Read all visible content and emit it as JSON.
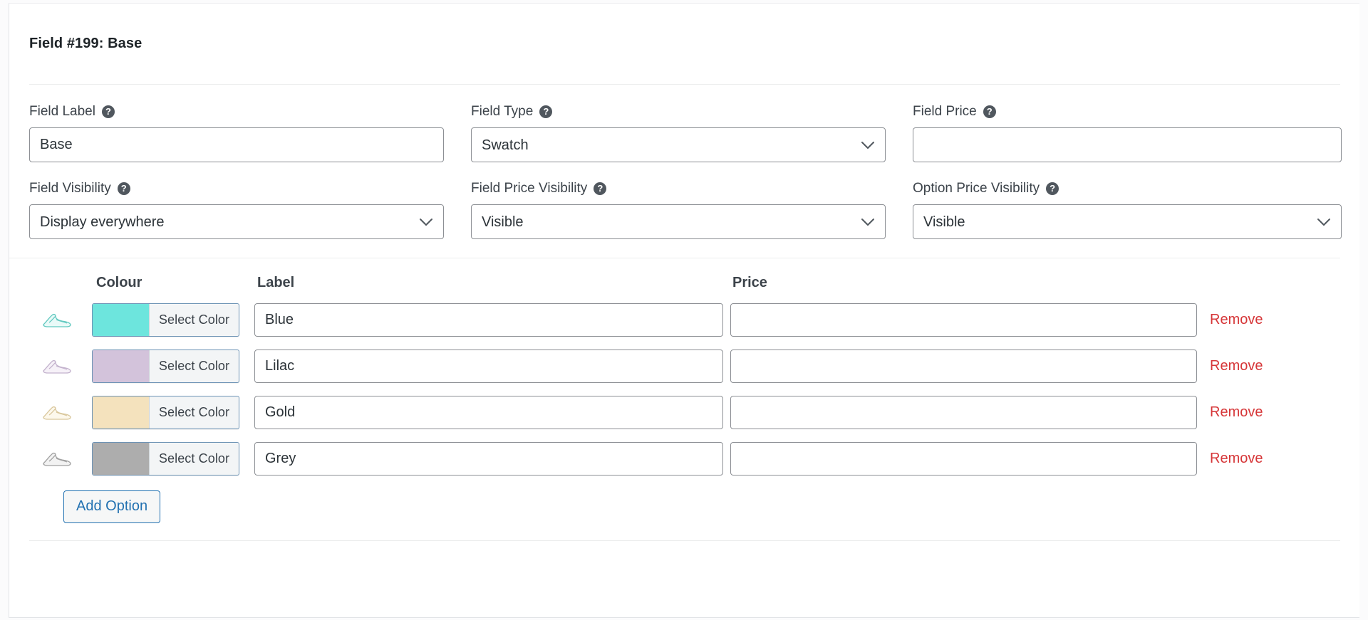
{
  "card": {
    "title": "Field #199: Base"
  },
  "form": {
    "fields": [
      {
        "label": "Field Label",
        "help": "?",
        "type": "text",
        "value": "Base",
        "placeholder": ""
      },
      {
        "label": "Field Type",
        "help": "?",
        "type": "select",
        "value": "Swatch",
        "options": [
          "Swatch"
        ]
      },
      {
        "label": "Field Price",
        "help": "?",
        "type": "text",
        "value": "",
        "placeholder": ""
      },
      {
        "label": "Field Visibility",
        "help": "?",
        "type": "select",
        "value": "Display everywhere",
        "options": [
          "Display everywhere"
        ]
      },
      {
        "label": "Field Price Visibility",
        "help": "?",
        "type": "select",
        "value": "Visible",
        "options": [
          "Visible"
        ]
      },
      {
        "label": "Option Price Visibility",
        "help": "?",
        "type": "select",
        "value": "Visible",
        "options": [
          "Visible"
        ]
      }
    ]
  },
  "options_table": {
    "headers": {
      "colour": "Colour",
      "label": "Label",
      "price": "Price"
    },
    "select_color_label": "Select Color",
    "remove_label": "Remove",
    "rows": [
      {
        "swatch_hex": "#6de5dd",
        "thumb_hex": "#7fdcd4",
        "label_value": "Blue",
        "price_value": "",
        "price_placeholder": "",
        "select_color_label": "Select Color",
        "remove_label": "Remove"
      },
      {
        "swatch_hex": "#d3c3db",
        "thumb_hex": "#cbbdd4",
        "label_value": "Lilac",
        "price_value": "",
        "price_placeholder": "",
        "select_color_label": "Select Color",
        "remove_label": "Remove"
      },
      {
        "swatch_hex": "#f4e2bd",
        "thumb_hex": "#e6d9bb",
        "label_value": "Gold",
        "price_value": "",
        "price_placeholder": "",
        "select_color_label": "Select Color",
        "remove_label": "Remove"
      },
      {
        "swatch_hex": "#adadad",
        "thumb_hex": "#a9a9a9",
        "label_value": "Grey",
        "price_value": "",
        "price_placeholder": "",
        "select_color_label": "Select Color",
        "remove_label": "Remove"
      }
    ]
  },
  "actions": {
    "add_option_label": "Add Option"
  },
  "colors": {
    "accent_blue": "#2271b1",
    "remove_red": "#d63638",
    "border_grey": "#8c8f94",
    "text_dark": "#1d2327",
    "text_body": "#3c434a"
  }
}
